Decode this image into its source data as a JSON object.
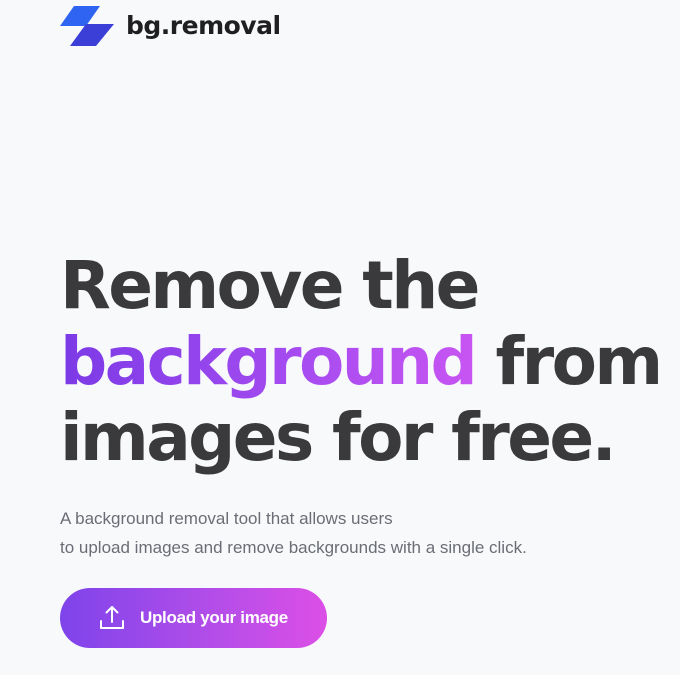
{
  "header": {
    "logo_icon": "bg-removal-logo-icon",
    "brand_name": "bg.removal"
  },
  "hero": {
    "title_line1": "Remove the",
    "title_line2_accent": "background",
    "title_line2_rest": " from",
    "title_line3": "images for free.",
    "subtitle_line1": "A background removal tool that allows users",
    "subtitle_line2": "to upload images and remove backgrounds with a single click."
  },
  "upload_button": {
    "icon": "upload-icon",
    "label": "Upload your image"
  },
  "colors": {
    "background": "#f8f9fb",
    "text_dark": "#3a3a3c",
    "text_muted": "#6b6d76",
    "accent_start": "#7b3ae6",
    "accent_end": "#dc4fe6",
    "logo_blue": "#2f62f0",
    "logo_indigo": "#3b3fd8"
  }
}
